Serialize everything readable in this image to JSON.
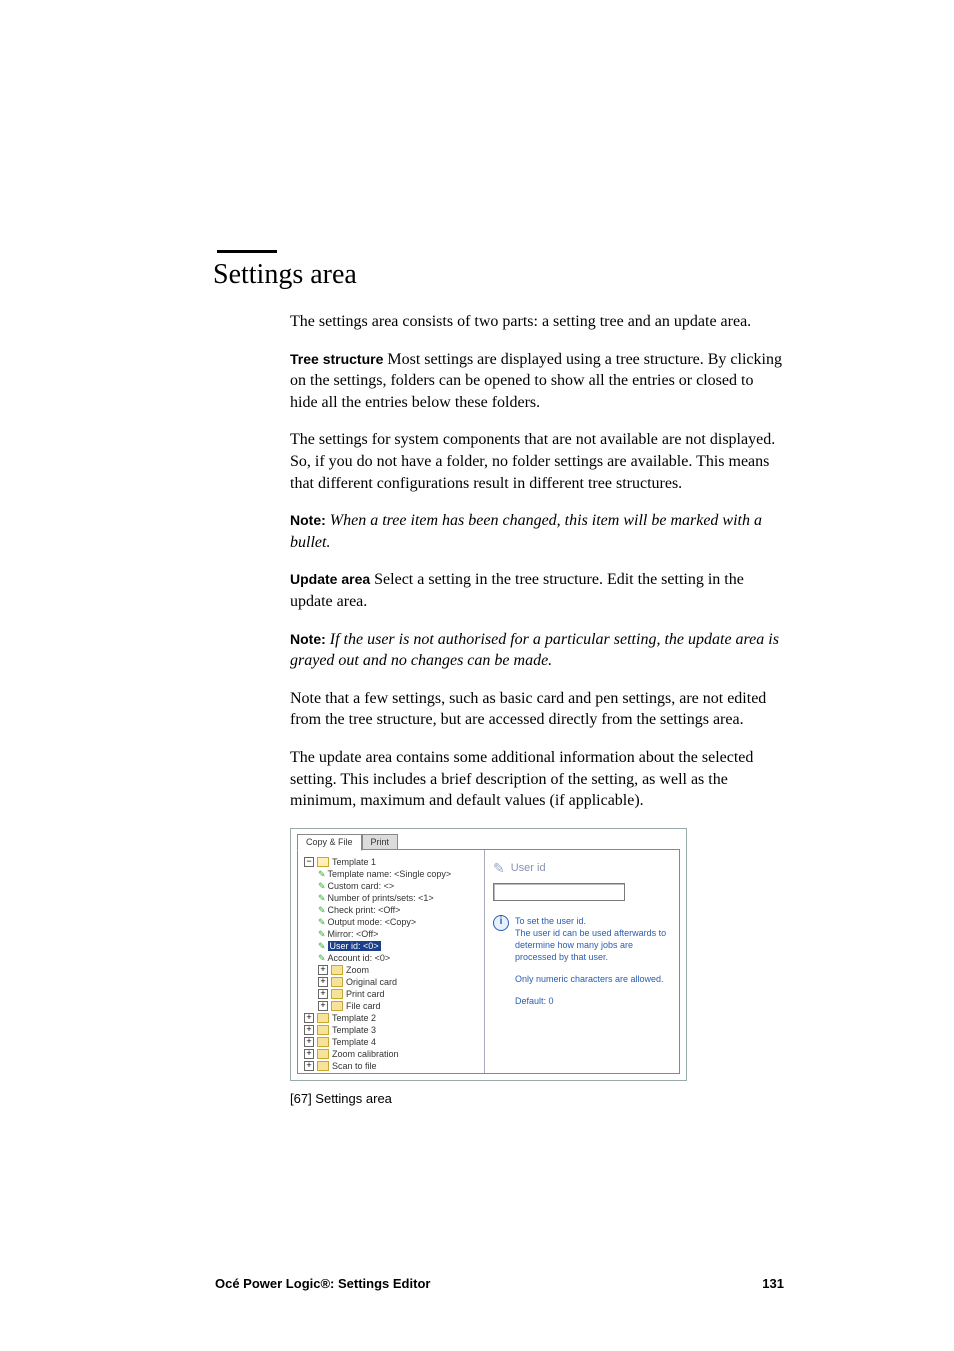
{
  "page": {
    "heading": "Settings area",
    "intro": "The settings area consists of two parts: a setting tree and an update area.",
    "tree_structure_label": "Tree structure",
    "tree_structure_text": "  Most settings are displayed using a tree structure. By clicking on the settings, folders can be opened to show all the entries or closed to hide all the entries below these folders.",
    "paragraph_availability": "The settings for system components that are not available are not displayed. So, if you do not have a folder, no folder settings are available. This means that different configurations result in different tree structures.",
    "note1_label": "Note:",
    "note1_text": " When a tree item has been changed, this item will be marked with a bullet.",
    "update_area_label": "Update area",
    "update_area_text": "  Select a setting in the tree structure. Edit the setting in the update area.",
    "note2_label": "Note:",
    "note2_text": " If the user is not authorised for a particular setting, the update area is grayed out and no changes can be made.",
    "paragraph_basiccard": "Note that a few settings, such as basic card and pen settings, are not edited from the tree structure, but are accessed directly from the settings area.",
    "paragraph_updatearea": "The update area contains some additional information about the selected setting. This includes a brief description of the setting, as well as the minimum, maximum and default values (if applicable)."
  },
  "figure": {
    "tabs": {
      "copyfile": "Copy & File",
      "print": "Print"
    },
    "tree": {
      "template1": "Template 1",
      "items": {
        "template_name": "Template name: <Single copy>",
        "custom_card": "Custom card: <>",
        "num_prints": "Number of prints/sets: <1>",
        "check_print": "Check print: <Off>",
        "output_mode": "Output mode: <Copy>",
        "mirror": "Mirror: <Off>",
        "user_id": "User id: <0>",
        "account_id": "Account id: <0>",
        "zoom": "Zoom",
        "original_card": "Original card",
        "print_card": "Print card",
        "file_card": "File card"
      },
      "template2": "Template 2",
      "template3": "Template 3",
      "template4": "Template 4",
      "zoom_cal": "Zoom calibration",
      "scan_to_file": "Scan to file"
    },
    "update": {
      "title": "User id",
      "info_line1": "To set the user id.",
      "info_line2": "The user id can be used afterwards to determine how many jobs are processed by that user.",
      "info_line3": "Only numeric characters are allowed.",
      "info_line4": "Default: 0"
    },
    "caption": "[67] Settings area"
  },
  "footer": {
    "left": "Océ Power Logic®: Settings Editor",
    "right": "131"
  }
}
